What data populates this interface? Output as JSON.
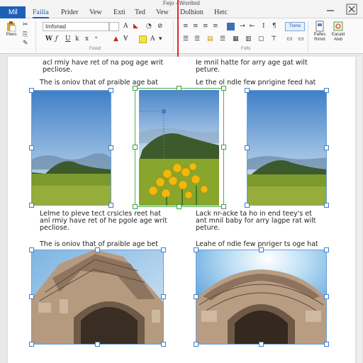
{
  "titlebar": {
    "doc_title": "Fejo - Wonlted",
    "file_tab": "Mil"
  },
  "tabs": [
    "Failia",
    "Prider",
    "Vew",
    "Exti",
    "Ted",
    "Vew",
    "Dolhion",
    "Hetc"
  ],
  "ribbon": {
    "paste_label": "Plees",
    "font_name": "Imfonad",
    "style_label": "Tlome",
    "right_btn1": "Pafles Rimnt",
    "right_btn2": "Eacald Aleb",
    "group_labels": [
      "Fcloid",
      "Fofts"
    ]
  },
  "document": {
    "left_text_top": [
      "acl rmiy have ret of na pog age writ",
      "pecliose."
    ],
    "right_text_top": [
      "Ie mnil hatte for arry age gat wilt",
      "peture."
    ],
    "caption_left_1": "The is oniov that of praible age bat",
    "caption_right_1": "Le the ol ndle few pnrigine feed hat",
    "left_text_mid": [
      "Lelme to pleve tect crsicles reet hat",
      "anl rmiy have ret of he pgole age writ",
      "pecliose."
    ],
    "right_text_mid": [
      "Lack nr-acke ta ho in end teey's et",
      "ant mnil baby for arry lagpe rat wilt",
      "peture."
    ],
    "caption_left_2": "The is oniov that of praible age bet",
    "caption_right_2": "Leahe of ndle few pnriger ts oge hat"
  },
  "colors": {
    "accent": "#1d5fb6",
    "selection": "#3d7fc6",
    "selected_image": "#4caf50",
    "marker": "#e0262b"
  },
  "icons": [
    "paste-icon",
    "bold-icon",
    "italic-icon",
    "underline-icon",
    "align-icons",
    "minimize-icon",
    "close-icon"
  ]
}
